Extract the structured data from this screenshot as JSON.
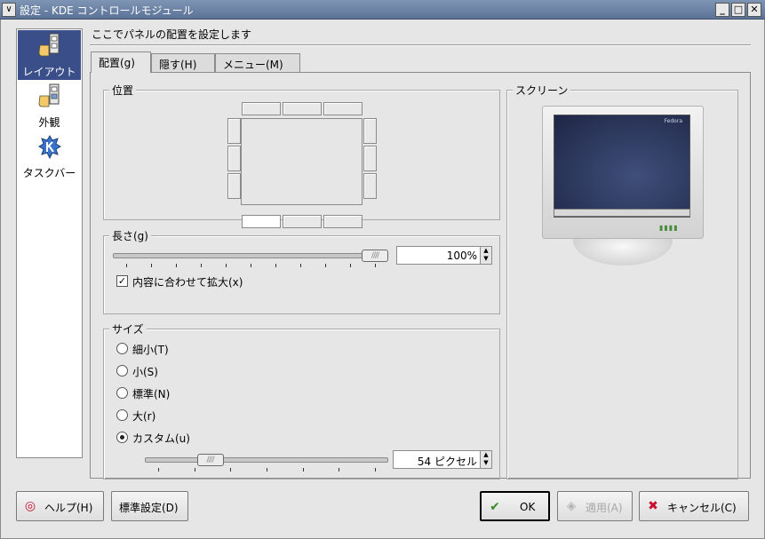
{
  "window": {
    "title": "設定 - KDE コントロールモジュール",
    "menu_glyph": "∨",
    "minimize_glyph": "_",
    "maximize_glyph": "□",
    "close_glyph": "✕"
  },
  "sidebar": {
    "items": [
      {
        "label": "レイアウト",
        "icon": "panel-layout-icon",
        "active": true
      },
      {
        "label": "外観",
        "icon": "panel-appearance-icon",
        "active": false
      },
      {
        "label": "タスクバー",
        "icon": "kde-taskbar-icon",
        "active": false
      }
    ]
  },
  "heading": "ここでパネルの配置を設定します",
  "tabs": [
    {
      "label": "配置(g)",
      "active": true
    },
    {
      "label": "隠す(H)",
      "active": false
    },
    {
      "label": "メニュー(M)",
      "active": false
    }
  ],
  "position": {
    "title": "位置",
    "selected": "bottom-left"
  },
  "length": {
    "title": "長さ(g)",
    "value_text": "100%",
    "value_fraction": 1.0,
    "expand_label": "内容に合わせて拡大(x)",
    "expand_checked": true
  },
  "size": {
    "title": "サイズ",
    "options": [
      {
        "label": "細小(T)",
        "selected": false
      },
      {
        "label": "小(S)",
        "selected": false
      },
      {
        "label": "標準(N)",
        "selected": false
      },
      {
        "label": "大(r)",
        "selected": false
      },
      {
        "label": "カスタム(u)",
        "selected": true
      }
    ],
    "custom_value_text": "54 ピクセル",
    "custom_value_fraction": 0.24
  },
  "screen": {
    "title": "スクリーン",
    "logo_text": "Fedora"
  },
  "buttons": {
    "help": "ヘルプ(H)",
    "defaults": "標準設定(D)",
    "ok": "OK",
    "apply": "適用(A)",
    "cancel": "キャンセル(C)"
  },
  "colors": {
    "titlebar": "#6a82a6",
    "sidebar_active": "#3a4f8a",
    "cancel_icon": "#c8102e",
    "ok_icon": "#3b8a2a"
  }
}
